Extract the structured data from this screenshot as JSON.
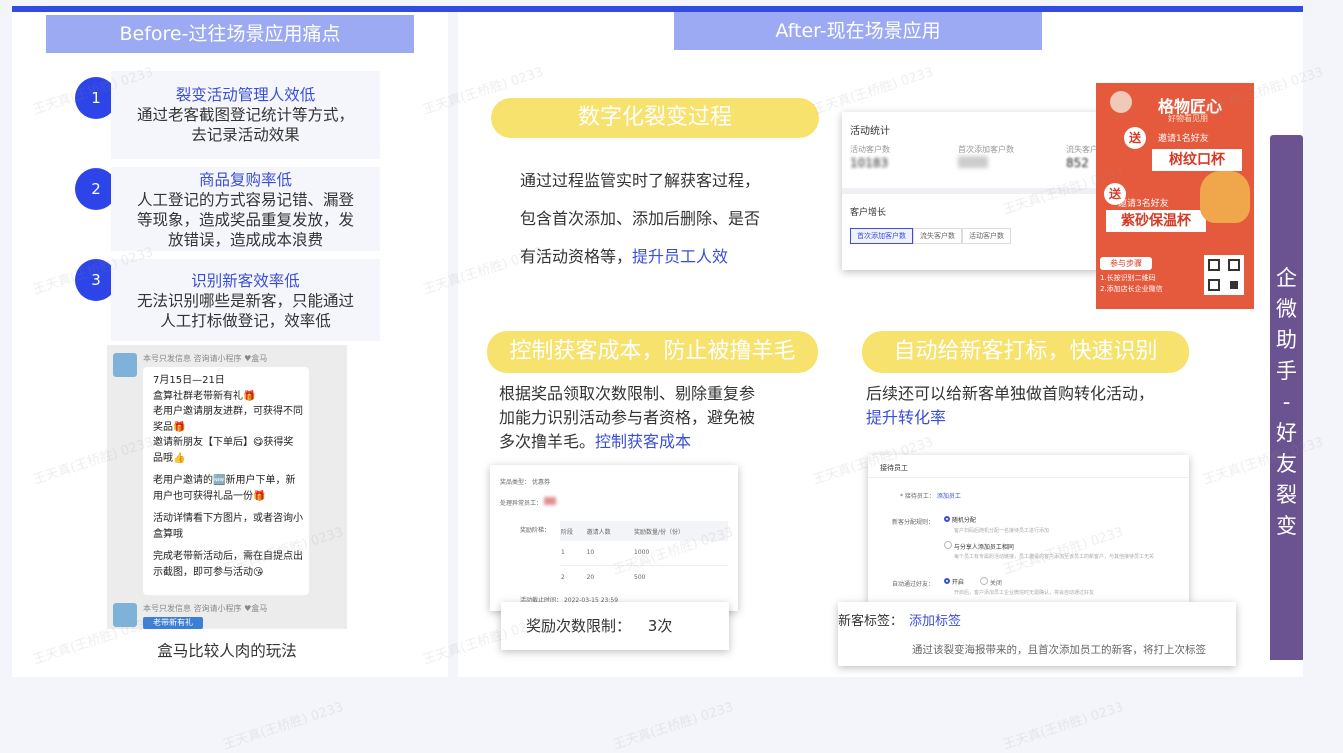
{
  "before": {
    "header": "Before-过往场景应用痛点",
    "pains": [
      {
        "num": "1",
        "title": "裂变活动管理人效低",
        "body": [
          "通过老客截图登记统计等方式，",
          "去记录活动效果"
        ]
      },
      {
        "num": "2",
        "title": "商品复购率低",
        "body": [
          "人工登记的方式容易记错、漏登",
          "等现象，造成奖品重复发放，发",
          "放错误，造成成本浪费"
        ]
      },
      {
        "num": "3",
        "title": "识别新客效率低",
        "body": [
          "无法识别哪些是新客，只能通过",
          "人工打标做登记，效率低"
        ]
      }
    ],
    "chat": {
      "sender": "本号只发信息 咨询请小程序 ♥盒马",
      "lines": [
        "7月15日—21日",
        "盒算社群老带新有礼🎁",
        "老用户邀请朋友进群，可获得不同奖品🎁",
        "邀请新朋友【下单后】😋获得奖品哦👍",
        "老用户邀请的🆕新用户下单，新用户也可获得礼品一份🎁",
        "活动详情看下方图片，或者咨询小盒算哦",
        "完成老带新活动后，需在自提点出示截图，即可参与活动😘"
      ],
      "bottom_sender": "本号只发信息 咨询请小程序 ♥盒马",
      "sticker": "老带新有礼"
    },
    "caption": "盒马比较人肉的玩法"
  },
  "after": {
    "header": "After-现在场景应用",
    "section1": {
      "pill": "数字化裂变过程",
      "lines": [
        "通过过程监管实时了解获客过程，",
        "包含首次添加、添加后删除、是否"
      ],
      "line3_prefix": "有活动资格等，",
      "line3_link": "提升员工人效"
    },
    "section2": {
      "pill": "控制获客成本，防止被撸羊毛",
      "lines": [
        "根据奖品领取次数限制、剔除重复参",
        "加能力识别活动参与者资格，避免被"
      ],
      "line3_prefix": "多次撸羊毛。",
      "line3_link": "控制获客成本"
    },
    "section3": {
      "pill": "自动给新客打标，快速识别",
      "lines": [
        "后续还可以给新客单独做首购转化活动，"
      ],
      "link": "提升转化率"
    },
    "stats_card": {
      "title": "活动统计",
      "cols": [
        {
          "label": "活动客户数",
          "value": "10183"
        },
        {
          "label": "首次添加客户数",
          "value": "—"
        },
        {
          "label": "流失客户数",
          "value": "852"
        }
      ],
      "growth_title": "客户增长",
      "tabs": [
        "首次添加客户数",
        "流失客户数",
        "活动客户数"
      ]
    },
    "poster": {
      "brand": "格物匠心",
      "sub": "好物看见朋",
      "badge1": "送",
      "line1": "邀请1名好友",
      "prize1": "树纹口杯",
      "badge2": "送",
      "line2": "邀请3名好友",
      "prize2": "紫砂保温杯",
      "steps_title": "参与步骤",
      "steps": [
        "1.长按识别二维码",
        "2.添加店长企业微信"
      ]
    },
    "limit_card": {
      "rows": [
        {
          "k": "奖品类型：",
          "v": "优惠券"
        },
        {
          "k": "处理异常员工：",
          "v": ""
        }
      ],
      "table_label": "奖励阶梯：",
      "table_head": [
        "阶段",
        "邀请人数",
        "奖励数量/份（份）"
      ],
      "table_rows": [
        [
          "1",
          "10",
          "1000"
        ],
        [
          "2",
          "20",
          "500"
        ]
      ],
      "deadline_label": "活动截止时间：",
      "deadline": "2022-03-15 23:59",
      "overlay_label": "奖励次数限制：",
      "overlay_value": "3次"
    },
    "tag_card": {
      "title": "接待员工",
      "staff_label": "* 接待员工：",
      "staff_link": "添加员工",
      "assign_label": "新客分配规则：",
      "opt1": "随机分配",
      "opt1_desc": "客户扫码后随机分配一名接待员工进行添加",
      "opt2": "与分享人添加员工相同",
      "opt2_desc": "每个员工有专属的活动链接，员工邀请的客户添加至该员工的新客户，与其他接待员工无关",
      "auto_label": "自动通过好友：",
      "on": "开启",
      "off": "关闭",
      "auto_desc": "开启后，客户添加员工企业微信时无需确认，将会自动通过好友",
      "overlay_label": "新客标签：",
      "overlay_link": "添加标签",
      "overlay_desc": "通过该裂变海报带来的，且首次添加员工的新客，将打上次标签"
    }
  },
  "side_label": [
    "企",
    "微",
    "助",
    "手",
    "-",
    "好",
    "友",
    "裂",
    "变"
  ],
  "watermark": "王天真(王桥胜) 0233",
  "colors": {
    "primary": "#2f4de0",
    "header_bg": "#9ca9f3",
    "pill": "#f7e26e",
    "side": "#6b5392",
    "link": "#3a4fd8"
  }
}
